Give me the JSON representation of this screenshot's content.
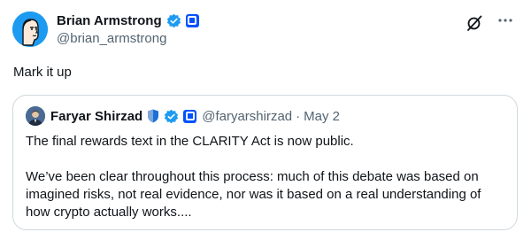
{
  "tweet": {
    "author": {
      "display_name": "Brian Armstrong",
      "handle": "@brian_armstrong"
    },
    "text": "Mark it up"
  },
  "quoted_tweet": {
    "author": {
      "display_name": "Faryar Shirzad",
      "handle": "@faryarshirzad"
    },
    "separator": "·",
    "date": "May 2",
    "paragraphs": [
      "The final rewards text in the CLARITY Act is now public.",
      "We’ve been clear throughout this process: much of this debate was based on imagined risks, not real evidence, nor was it based on a real understanding of how crypto actually works...."
    ]
  },
  "icons": {
    "verified": "verified-badge-icon",
    "affiliate": "coinbase-affiliate-icon",
    "government": "government-shield-icon",
    "grok": "grok-icon",
    "more": "more-icon"
  },
  "colors": {
    "verified_blue": "#1d9bf0",
    "affiliate_blue": "#0052ff",
    "secondary_text": "#536471",
    "border": "#cfd9de"
  }
}
